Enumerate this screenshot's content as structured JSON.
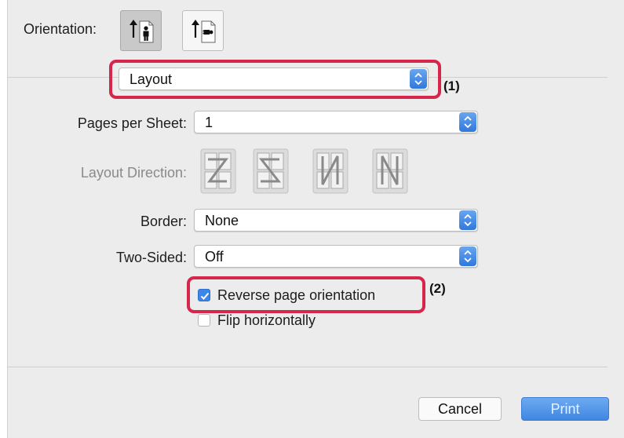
{
  "orientation": {
    "label": "Orientation:",
    "options": [
      {
        "icon": "portrait-orientation-icon",
        "selected": true
      },
      {
        "icon": "landscape-orientation-icon",
        "selected": false
      }
    ]
  },
  "section_popup": {
    "value": "Layout"
  },
  "annotations": {
    "one": "(1)",
    "two": "(2)"
  },
  "pages_per_sheet": {
    "label": "Pages per Sheet:",
    "value": "1"
  },
  "layout_direction": {
    "label": "Layout Direction:",
    "enabled": false,
    "options": [
      "z-order-icon",
      "reverse-z-order-icon",
      "n-order-icon",
      "reverse-n-order-icon"
    ]
  },
  "border": {
    "label": "Border:",
    "value": "None"
  },
  "two_sided": {
    "label": "Two-Sided:",
    "value": "Off"
  },
  "reverse_orientation": {
    "label": "Reverse page orientation",
    "checked": true
  },
  "flip_horizontally": {
    "label": "Flip horizontally",
    "checked": false
  },
  "buttons": {
    "cancel": "Cancel",
    "print": "Print"
  },
  "colors": {
    "accent": "#3b86e8",
    "highlight": "#d6264c",
    "panel": "#ececec"
  }
}
